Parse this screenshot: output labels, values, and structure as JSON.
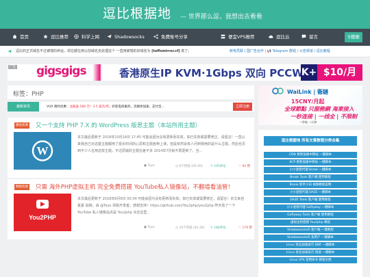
{
  "site": {
    "title": "逗比根据地",
    "subtitle": "— 世界那么逗，我想出去看看"
  },
  "nav": {
    "items": [
      {
        "label": "首页",
        "icon": "home-icon"
      },
      {
        "label": "逗比推荐",
        "icon": "star-icon"
      },
      {
        "label": "科学上网",
        "icon": "globe-icon"
      },
      {
        "label": "Shadowsocks",
        "icon": "paper-plane-icon"
      },
      {
        "label": "免费账号分享",
        "icon": "share-icon"
      },
      {
        "label": "便宜VPS推荐",
        "icon": "server-icon"
      },
      {
        "label": "逗比云",
        "icon": "cloud-icon"
      },
      {
        "label": "留言",
        "icon": "comment-icon"
      }
    ],
    "search_label": "搜索"
  },
  "notice": {
    "text_prefix": "逗比的正式域名不过被墙的命运，现在都在用以前域名去处理这个 一直用被墙的旧域名为 ",
    "text_domain": "[toffsmirror.cf]",
    "text_suffix": " 真了。",
    "links": "新电员联 | 国广告合作 | 📢 Telegram 群组 / 公告频道 / 逗比教程"
  },
  "banner": {
    "ad_label": "广告",
    "logo": "gigsgigs",
    "text": "香港原生IP  KVM·1Gbps  双向 PCCW HKBN",
    "plus": "K+",
    "price": "$10/月"
  },
  "tag_page": {
    "title": "标签：PHP"
  },
  "ticker": {
    "button": "最新资讯",
    "text_a": "VUR 限时优惠：",
    "text_b": "注册送 588 万！3.5 美元/月，",
    "text_c": "护航电商服务，流媒体加速，支付宝...",
    "submit": "立即注册"
  },
  "posts": [
    {
      "badge": "建站资源",
      "title": "又一个支持 PHP 7.X 的 WordPress 版思主题（本站所用主题）",
      "thumb_label": "WordPress",
      "excerpt": "本文最后更新于 2018年10月16日 17:45 可能会因为没有更新而失效。如已失效或需要修正，请留言！一直以来我自己对这套主题都用了挺长时间的心思和主题各种上课，但是依然会有人问到我用的是什么主题，然后也见到不少人在用这款主题，不过原版的主题在差不多 2014年7月就不再更新了，当...",
      "author": "Toyo",
      "time": "6个月前 (05-20)",
      "comments": "105评论",
      "likes": "92 赞"
    },
    {
      "badge": "网络资源",
      "title": "只需 海外PHP虚拟主机 完全免费搭建 YouTube私人镜像站，不翻墙看油管！",
      "thumb_label": "You2PHP",
      "excerpt": "本文最后更新于 2018年6月6日 00:34 可能会因为没有更新而失效。如已失效或需要修正，请留言！本文来自 夏夏 投稿，由 @Toyo 测看开发者，感谢支持！https://github.com/You2php/you2php 昨天看了一下 YouTube 私人镜像站点是 You2php 点击这里...",
      "author": "Toyo",
      "time": "10个月前 (01-26)",
      "comments": "184评论",
      "likes": "179 赞"
    }
  ],
  "sidebar_ad": {
    "brand": "WaiLink | 衞鏈",
    "price": "15CNY/月起",
    "slogan1": "全球節點 只服務網 海東接入",
    "slogan2": "一秒连接 | 一线全 | 不限制",
    "foot": "一秒链 一分钟"
  },
  "sidebar": {
    "title": "逗比根据地 所有文章教程分类合集",
    "items": [
      "CDN 更新加速中转站 一键脚本",
      "KCP 更新加速中转站 一键脚本",
      "小小混搭代理 Brook 一键脚本",
      "Brook Tools 客户端 使用教程",
      "Brook 新手小白 视频教程说明",
      "小小混搭代理 DAZE 一键脚本",
      "DAZE Tools 客户端 使用教程",
      "小小混搭代理 Goflyway 一键脚本",
      "Goflyway Tools 客户端 使用教程",
      "虚拟主机搭建 You2php 教程",
      "ShadowsocksR 客户端 一键教程",
      "ShadowsocksR 多用户 一键脚本",
      "Linux 优化加速技巧 BBR 一键脚本",
      "Linux 优化加速技巧 锐速 一键脚本",
      "Linux VPS 常用命令 教程文档"
    ]
  }
}
